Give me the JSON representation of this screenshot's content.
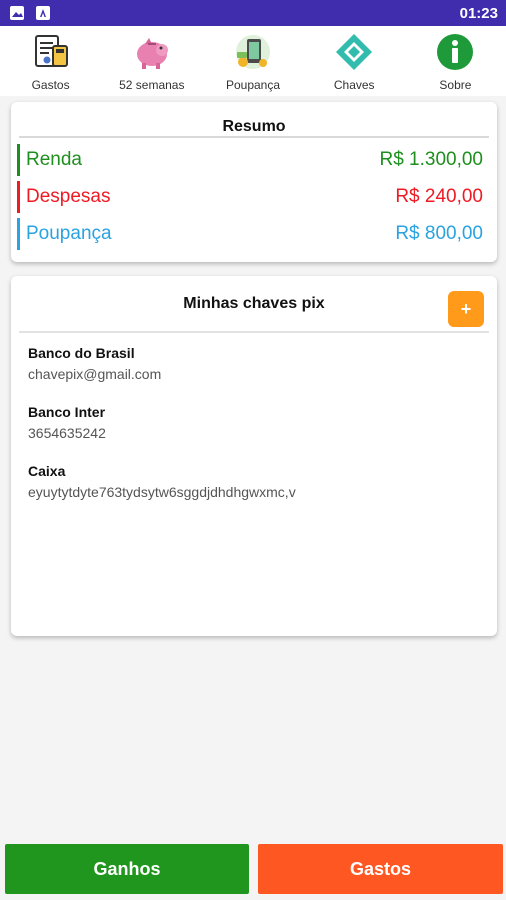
{
  "status_bar": {
    "time": "01:23",
    "icons": [
      "image-icon",
      "font-icon"
    ]
  },
  "nav": [
    {
      "label": "Gastos",
      "icon": "receipt-icon"
    },
    {
      "label": "52 semanas",
      "icon": "piggy-bank-icon"
    },
    {
      "label": "Poupança",
      "icon": "savings-phone-icon"
    },
    {
      "label": "Chaves",
      "icon": "pix-icon"
    },
    {
      "label": "Sobre",
      "icon": "info-icon"
    }
  ],
  "resumo": {
    "title": "Resumo",
    "rows": [
      {
        "label": "Renda",
        "value": "R$ 1.300,00"
      },
      {
        "label": "Despesas",
        "value": "R$ 240,00"
      },
      {
        "label": "Poupança",
        "value": "R$ 800,00"
      }
    ]
  },
  "pix": {
    "title": "Minhas chaves pix",
    "add_label": "+",
    "items": [
      {
        "bank": "Banco do Brasil",
        "key": "chavepix@gmail.com"
      },
      {
        "bank": "Banco Inter",
        "key": "3654635242"
      },
      {
        "bank": "Caixa",
        "key": "eyuytytdyte763tydsytw6sggdjdhdhgwxmc,v"
      }
    ]
  },
  "buttons": {
    "ganhos": "Ganhos",
    "gastos": "Gastos"
  },
  "colors": {
    "status_bar": "#3f2dae",
    "renda": "#1e8f1e",
    "despesas": "#ee1b24",
    "poupanca": "#2aa3e0",
    "add": "#ff9a1a",
    "ganhos": "#21961e",
    "gastos": "#ff5722"
  }
}
